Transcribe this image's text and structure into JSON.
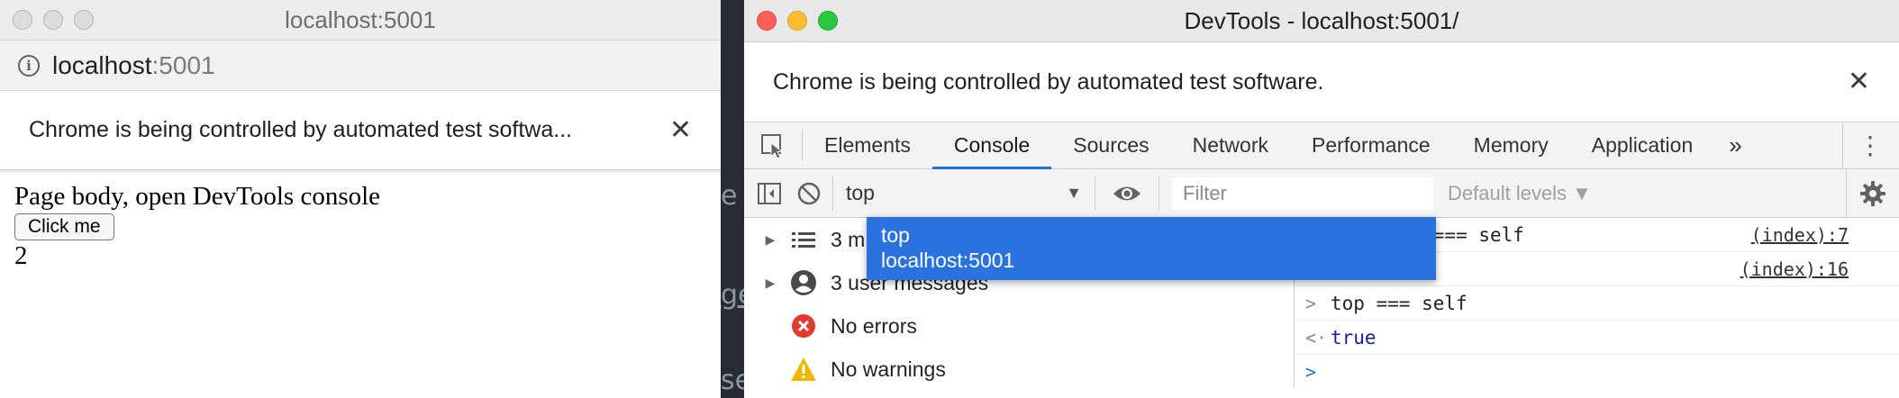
{
  "left_window": {
    "title": "localhost:5001",
    "address_host": "localhost",
    "address_port": ":5001",
    "infobar_text": "Chrome is being controlled by automated test softwa...",
    "page": {
      "text": "Page body, open DevTools console",
      "button_label": "Click me",
      "count": "2"
    }
  },
  "background_fragments": [
    "e",
    "ge",
    "se"
  ],
  "devtools": {
    "title": "DevTools - localhost:5001/",
    "infobar_text": "Chrome is being controlled by automated test software.",
    "tabs": [
      "Elements",
      "Console",
      "Sources",
      "Network",
      "Performance",
      "Memory",
      "Application"
    ],
    "active_tab": "Console",
    "more_tabs": "»",
    "toolbar": {
      "context": "top",
      "filter_placeholder": "Filter",
      "levels": "Default levels ▼"
    },
    "context_dropdown": {
      "options": [
        "top",
        "localhost:5001"
      ]
    },
    "sidebar": {
      "items": [
        {
          "label": "3 messages",
          "visible_label": "3 m",
          "icon": "list-icon"
        },
        {
          "label": "3 user messages",
          "icon": "user-icon"
        },
        {
          "label": "No errors",
          "icon": "error-icon"
        },
        {
          "label": "No warnings",
          "icon": "warning-icon"
        }
      ]
    },
    "messages": [
      {
        "text": "ood, top === self",
        "source": "(index):7"
      },
      {
        "text": "",
        "source": "(index):16"
      },
      {
        "prompt": ">",
        "text": "top === self"
      },
      {
        "prompt": "<·",
        "text": "true"
      },
      {
        "prompt": ">",
        "text": ""
      }
    ]
  },
  "colors": {
    "accent": "#1a73e8",
    "dropdown_bg": "#2a72e0",
    "close_red": "#fe5f57",
    "minimize_yellow": "#febc2e",
    "zoom_green": "#28c840"
  }
}
